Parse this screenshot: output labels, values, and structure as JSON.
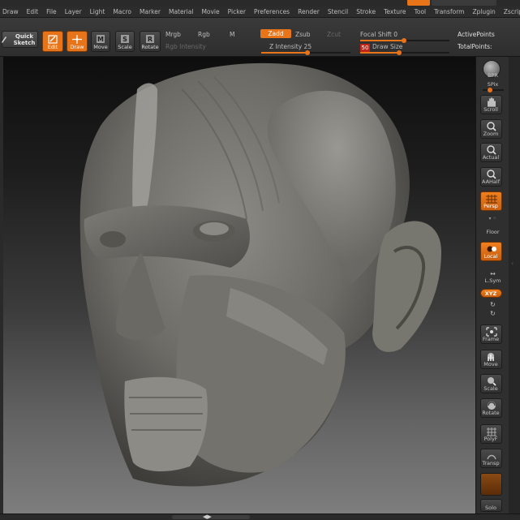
{
  "menu": {
    "items": [
      "Draw",
      "Edit",
      "File",
      "Layer",
      "Light",
      "Macro",
      "Marker",
      "Material",
      "Movie",
      "Picker",
      "Preferences",
      "Render",
      "Stencil",
      "Stroke",
      "Texture",
      "Tool",
      "Transform",
      "Zplugin",
      "Zscript"
    ]
  },
  "toolbar": {
    "quick_sketch": "Quick Sketch",
    "edit": "Edit",
    "draw": "Draw",
    "move": "Move",
    "scale": "Scale",
    "rotate": "Rotate",
    "mrgb": "Mrgb",
    "rgb": "Rgb",
    "m": "M",
    "rgb_intensity": "Rgb Intensity",
    "zadd": "Zadd",
    "zsub": "Zsub",
    "zcut": "Zcut",
    "z_intensity": "Z Intensity 25",
    "focal_shift": "Focal Shift 0",
    "draw_size_value": "50",
    "draw_size": "Draw Size",
    "active_points": "ActivePoints",
    "total_points": "TotalPoints:"
  },
  "shelf": {
    "bpr": "BPR",
    "spix": "SPix",
    "scroll": "Scroll",
    "zoom": "Zoom",
    "actual": "Actual",
    "aahalf": "AAHalf",
    "persp": "Persp",
    "floor": "Floor",
    "local": "Local",
    "lsym": "L.Sym",
    "xyz": "XYZ",
    "frame": "Frame",
    "move": "Move",
    "scale": "Scale",
    "rotate": "Rotate",
    "polyf": "PolyF",
    "transp": "Transp",
    "solo": "Solo"
  },
  "colors": {
    "accent": "#e8741a",
    "draw_size_badge": "#c0251b"
  }
}
